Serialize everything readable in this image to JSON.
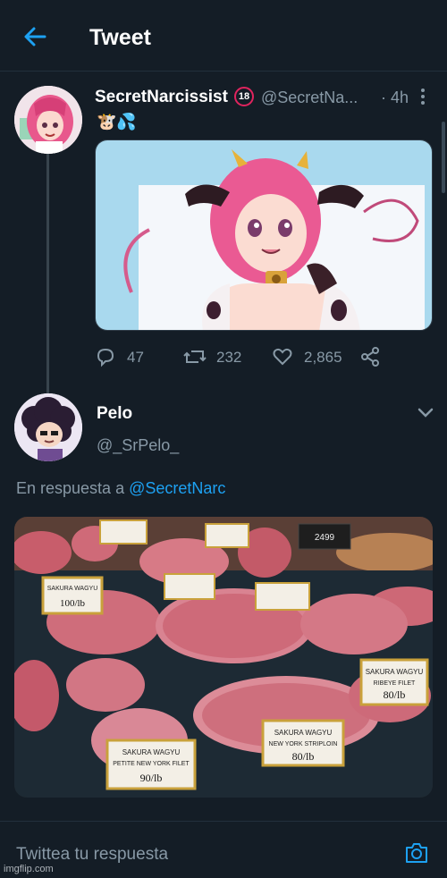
{
  "header": {
    "title": "Tweet"
  },
  "tweet": {
    "author_name": "SecretNarcissist",
    "age_badge": "18",
    "handle": "@SecretNa...",
    "time": "· 4h",
    "emojis": "🐮💦",
    "stats": {
      "replies": "47",
      "retweets": "232",
      "likes": "2,865"
    }
  },
  "reply": {
    "author_name": "Pelo",
    "handle": "@_SrPelo_",
    "prefix": "En respuesta a",
    "mention": "@SecretNarc",
    "price_tags": [
      {
        "line1": "SAKURA WAGYU",
        "line2": "PETITE NEW YORK FILET",
        "price": "90/lb"
      },
      {
        "line1": "SAKURA WAGYU",
        "line2": "NEW YORK STRIPLOIN",
        "price": "80/lb"
      },
      {
        "line1": "SAKURA WAGYU",
        "line2": "RIBEYE FILET",
        "price": "80/lb"
      },
      {
        "line1": "SAKURA WAGYU",
        "line2": "",
        "price": "100/lb"
      },
      {
        "line1": "SAKURA WAGYU",
        "line2": "",
        "price": "2499"
      }
    ]
  },
  "composer": {
    "placeholder": "Twittea tu respuesta"
  },
  "watermark": "imgflip.com",
  "colors": {
    "background": "#141d26",
    "accent": "#1da1f2",
    "muted": "#8899a6",
    "divider": "#22303c"
  }
}
